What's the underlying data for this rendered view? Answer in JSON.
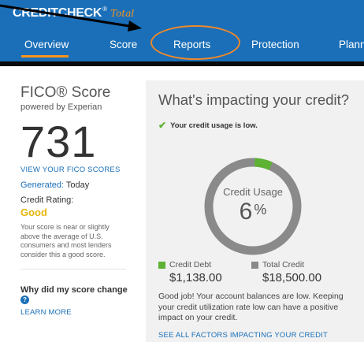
{
  "header": {
    "brand_main": "CREDIT",
    "brand_main2": "CHECK",
    "brand_sup": "®",
    "brand_script": "Total",
    "nav": [
      {
        "label": "Overview",
        "active": true
      },
      {
        "label": "Score",
        "active": false
      },
      {
        "label": "Reports",
        "active": false,
        "highlighted": true
      },
      {
        "label": "Protection",
        "active": false
      },
      {
        "label": "Plann",
        "active": false
      }
    ],
    "colors": {
      "bar": "#1a6fb8",
      "accent": "#f7941d"
    }
  },
  "left": {
    "fico_title": "FICO® Score",
    "fico_sub": "powered by Experian",
    "score": "731",
    "view_scores": "VIEW YOUR FICO SCORES",
    "generated_label": "Generated:",
    "generated_value": "Today",
    "rating_label": "Credit Rating:",
    "rating": "Good",
    "description": "Your score is near or slightly above the average of U.S. consumers and most lenders consider this a good score.",
    "why_title": "Why did my score change",
    "learn_more": "LEARN MORE"
  },
  "panel": {
    "title": "What's impacting your credit?",
    "status": "Your credit usage is low.",
    "donut_label": "Credit Usage",
    "donut_value": "6",
    "donut_unit": "%",
    "usage_fraction": 0.06,
    "debt_label": "Credit Debt",
    "debt_value": "$1,138.00",
    "total_label": "Total Credit",
    "total_value": "$18,500.00",
    "good_text": "Good job! Your account balances are low. Keeping your credit utilization rate low can have a positive impact on your credit.",
    "see_all": "SEE ALL FACTORS IMPACTING YOUR CREDIT",
    "colors": {
      "used": "#5db233",
      "ring": "#8a8a8a"
    }
  }
}
